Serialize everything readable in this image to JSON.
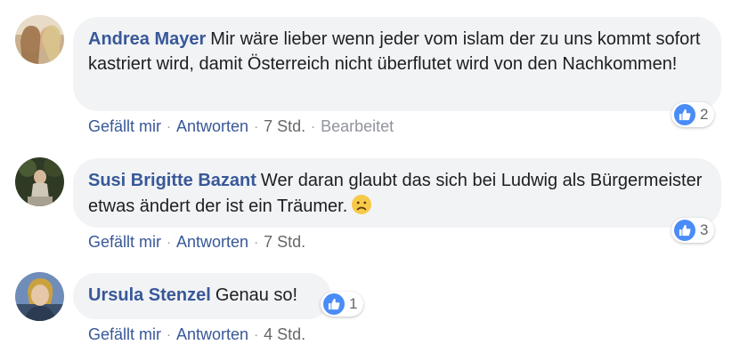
{
  "comments": [
    {
      "author": "Andrea Mayer",
      "text": "Mir wäre lieber wenn jeder vom islam der zu uns kommt sofort kastriert wird, damit Österreich nicht überflutet wird von den Nachkommen!",
      "reaction_count": "2",
      "actions": {
        "like": "Gefällt mir",
        "reply": "Antworten",
        "time": "7 Std.",
        "edited": "Bearbeitet"
      }
    },
    {
      "author": "Susi Brigitte Bazant",
      "text": "Wer daran glaubt das sich bei Ludwig als Bürgermeister etwas ändert der ist ein Träumer.",
      "emoji": "sad-face-emoji",
      "reaction_count": "3",
      "actions": {
        "like": "Gefällt mir",
        "reply": "Antworten",
        "time": "7 Std."
      }
    },
    {
      "author": "Ursula Stenzel",
      "text": "Genau so!",
      "reaction_count": "1",
      "actions": {
        "like": "Gefällt mir",
        "reply": "Antworten",
        "time": "4 Std."
      }
    }
  ],
  "colors": {
    "author_blue": "#385898",
    "bubble_gray": "#f2f3f5",
    "like_blue": "#4a8cf7",
    "meta_gray": "#65676b"
  }
}
